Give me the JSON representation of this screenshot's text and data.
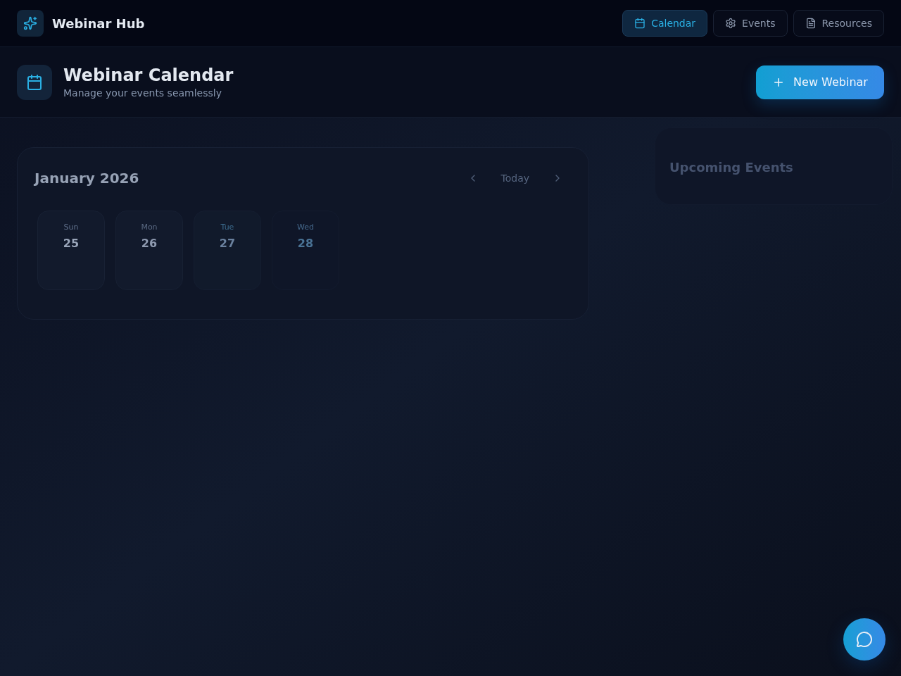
{
  "app": {
    "name": "Webinar Hub"
  },
  "nav": [
    {
      "label": "Calendar",
      "selected": true
    },
    {
      "label": "Events",
      "selected": false
    },
    {
      "label": "Resources",
      "selected": false
    }
  ],
  "page_header": {
    "title": "Webinar Calendar",
    "subtitle": "Manage your events seamlessly",
    "action": "New Webinar"
  },
  "calendar": {
    "month": "January 2026",
    "today": "Today",
    "days": [
      {
        "weekday": "Sun",
        "date": "25"
      },
      {
        "weekday": "Mon",
        "date": "26"
      },
      {
        "weekday": "Tue",
        "date": "27"
      },
      {
        "weekday": "Wed",
        "date": "28"
      }
    ]
  },
  "upcoming": {
    "title": "Upcoming Events"
  }
}
